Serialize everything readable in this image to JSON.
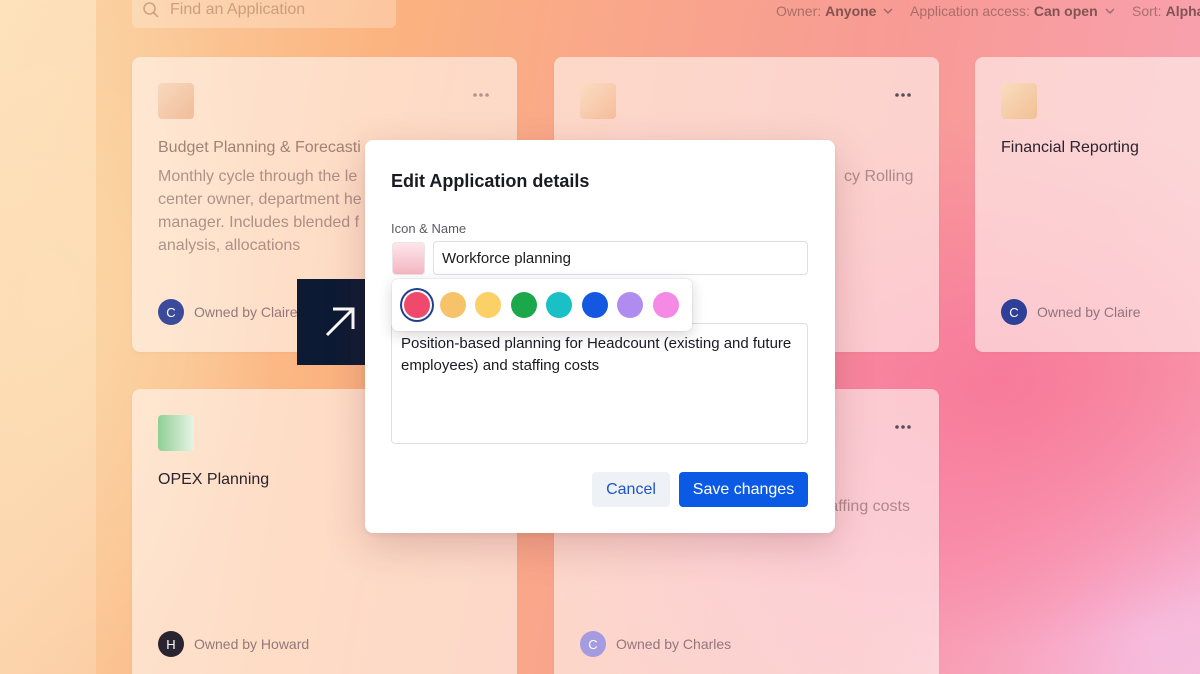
{
  "search": {
    "placeholder": "Find an Application"
  },
  "filters": [
    {
      "label": "Owner:",
      "value": "Anyone"
    },
    {
      "label": "Application access:",
      "value": "Can open"
    },
    {
      "label": "Sort:",
      "value": "Alpha"
    }
  ],
  "cards": [
    {
      "title": "Budget Planning & Forecasti",
      "description": "Monthly cycle through the le center owner, department he manager. Includes blended f analysis, allocations",
      "owner_initial": "C",
      "owner_text": "Owned by Claire",
      "avatar_color": "#3b4a9a",
      "tile_color": "#f3c7a6"
    },
    {
      "title": "",
      "description": "cy Rolling",
      "owner_initial": "",
      "owner_text": "",
      "avatar_color": "",
      "tile_color": "#f8caa9"
    },
    {
      "title": "Financial Reporting",
      "description": "",
      "owner_initial": "C",
      "owner_text": "Owned by Claire",
      "avatar_color": "#2d3f97",
      "tile_color": "#f4c49c"
    },
    {
      "title": "OPEX Planning",
      "description": "",
      "owner_initial": "H",
      "owner_text": "Owned by Howard",
      "avatar_color": "#2a2430",
      "tile_color": "#9fd3a2"
    },
    {
      "title": "",
      "description": "ount d staffing costs",
      "owner_initial": "C",
      "owner_text": "Owned by Charles",
      "avatar_color": "#a59be0",
      "tile_color": ""
    }
  ],
  "modal": {
    "title": "Edit Application details",
    "icon_name_label": "Icon & Name",
    "name_value": "Workforce planning",
    "description_value": "Position-based planning for Headcount (existing and future employees) and staffing costs",
    "cancel_label": "Cancel",
    "save_label": "Save changes"
  },
  "color_picker": {
    "swatches": [
      "#ef4a6b",
      "#f7c36a",
      "#fbd167",
      "#1aa84a",
      "#19c0c6",
      "#1457e0",
      "#b08cf0",
      "#f58ae6"
    ],
    "selected_index": 0
  },
  "colors": {
    "accent": "#0b5ae6",
    "arrow_badge": "#0d1a33"
  }
}
